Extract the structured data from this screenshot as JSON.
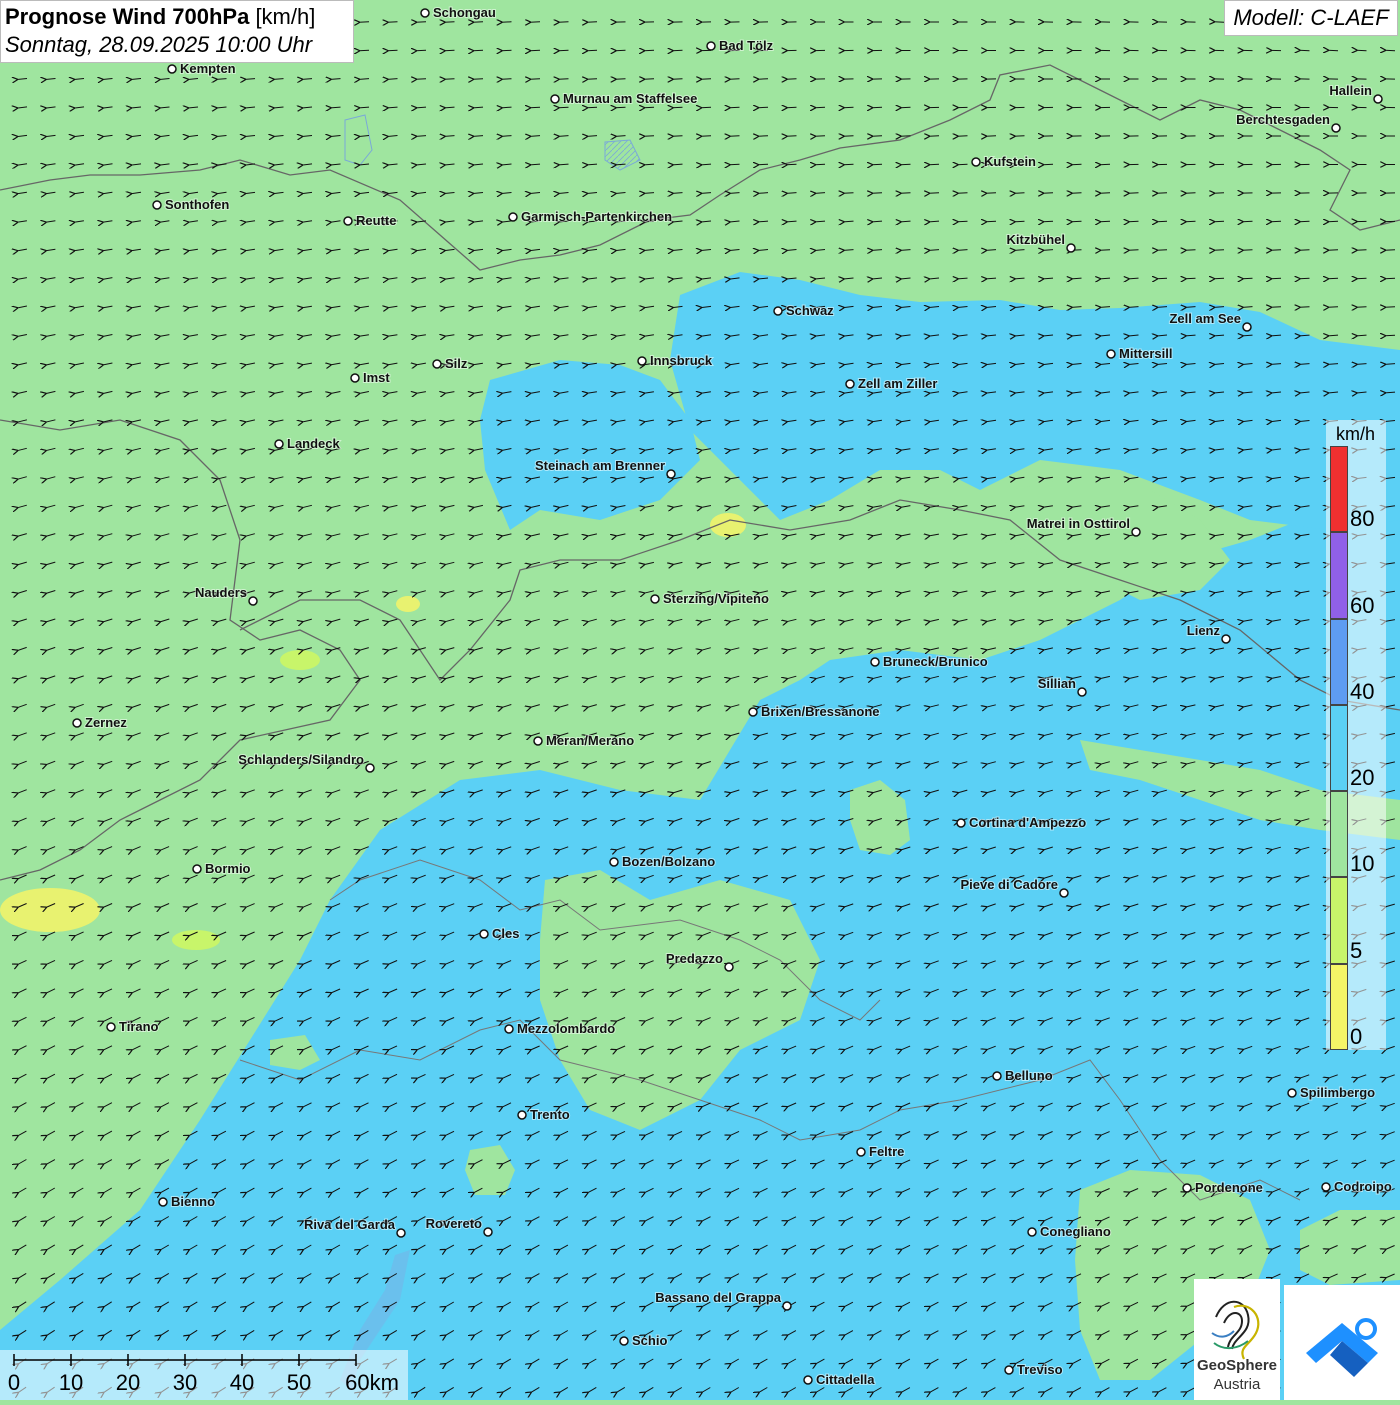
{
  "header": {
    "title_bold": "Prognose Wind 700hPa",
    "title_unit": "[km/h]",
    "subtitle": "Sonntag, 28.09.2025 10:00 Uhr",
    "model": "Modell: C-LAEF"
  },
  "colors": {
    "class_0_5": "#f5f567",
    "class_5_10": "#c8f56a",
    "class_10_20": "#9fe59f",
    "class_20_40": "#5bd0f5",
    "class_40_60": "#5e9cf2",
    "class_60_80": "#9060e8",
    "class_80_plus": "#f03030",
    "border": "#666666"
  },
  "legend": {
    "unit": "km/h",
    "ticks": [
      "0",
      "5",
      "10",
      "20",
      "40",
      "60",
      "80"
    ]
  },
  "scale_bar": {
    "labels": [
      "0",
      "10",
      "20",
      "30",
      "40",
      "50",
      "60km"
    ]
  },
  "wind": {
    "general_direction": "from east / north-east",
    "dominant_speed_classes": [
      "10-20",
      "20-40"
    ]
  },
  "cities": [
    {
      "name": "Schongau"
    },
    {
      "name": "Bad Tölz"
    },
    {
      "name": "Kempten"
    },
    {
      "name": "Murnau am Staffelsee"
    },
    {
      "name": "Hallein"
    },
    {
      "name": "Berchtesgaden"
    },
    {
      "name": "Kufstein"
    },
    {
      "name": "Sonthofen"
    },
    {
      "name": "Reutte"
    },
    {
      "name": "Garmisch-Partenkirchen"
    },
    {
      "name": "Kitzbühel"
    },
    {
      "name": "Schwaz"
    },
    {
      "name": "Zell am See"
    },
    {
      "name": "Innsbruck"
    },
    {
      "name": "Silz"
    },
    {
      "name": "Mittersill"
    },
    {
      "name": "Imst"
    },
    {
      "name": "Zell am Ziller"
    },
    {
      "name": "Landeck"
    },
    {
      "name": "Steinach am Brenner"
    },
    {
      "name": "Matrei in Osttirol"
    },
    {
      "name": "Nauders"
    },
    {
      "name": "Sterzing/Vipiteno"
    },
    {
      "name": "Lienz"
    },
    {
      "name": "Bruneck/Brunico"
    },
    {
      "name": "Sillian"
    },
    {
      "name": "Brixen/Bressanone"
    },
    {
      "name": "Zernez"
    },
    {
      "name": "Meran/Merano"
    },
    {
      "name": "Schlanders/Silandro"
    },
    {
      "name": "Cortina d'Ampezzo"
    },
    {
      "name": "Bozen/Bolzano"
    },
    {
      "name": "Bormio"
    },
    {
      "name": "Pieve di Cadore"
    },
    {
      "name": "Cles"
    },
    {
      "name": "Predazzo"
    },
    {
      "name": "Tirano"
    },
    {
      "name": "Mezzolombardo"
    },
    {
      "name": "Belluno"
    },
    {
      "name": "Spilimbergo"
    },
    {
      "name": "Trento"
    },
    {
      "name": "Feltre"
    },
    {
      "name": "Bienno"
    },
    {
      "name": "Pordenone"
    },
    {
      "name": "Codroipo"
    },
    {
      "name": "Riva del Garda"
    },
    {
      "name": "Rovereto"
    },
    {
      "name": "Conegliano"
    },
    {
      "name": "Bassano del Grappa"
    },
    {
      "name": "Schio"
    },
    {
      "name": "Treviso"
    },
    {
      "name": "Cittadella"
    }
  ],
  "logo": {
    "name_line1": "GeoSphere",
    "name_line2": "Austria"
  }
}
